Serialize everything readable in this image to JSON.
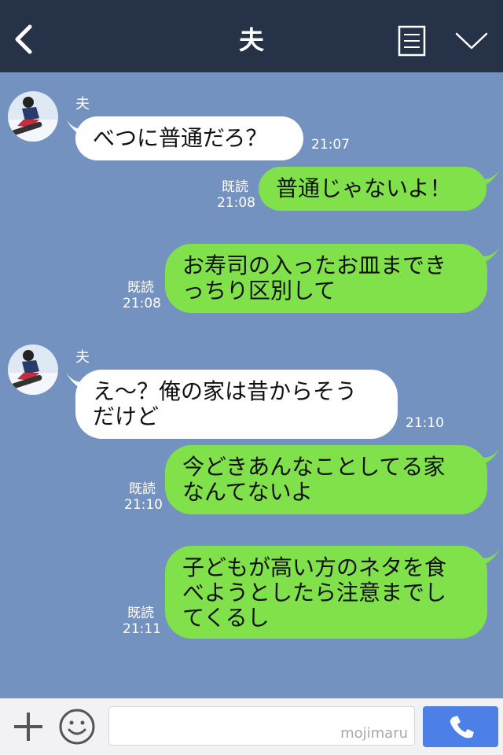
{
  "header": {
    "title": "夫",
    "back_icon": "chevron-left-icon",
    "note_icon": "note-list-icon",
    "menu_icon": "chevron-down-icon"
  },
  "messages": [
    {
      "from": "in",
      "sender": "夫",
      "text": "べつに普通だろ？",
      "time": "21:07"
    },
    {
      "from": "out",
      "read": "既読",
      "text": "普通じゃないよ！",
      "time": "21:08"
    },
    {
      "from": "out",
      "read": "既読",
      "text": "お寿司の入ったお皿までき\nっちり区別して",
      "time": "21:08"
    },
    {
      "from": "in",
      "sender": "夫",
      "text": "え〜？俺の家は昔からそう\nだけど",
      "time": "21:10"
    },
    {
      "from": "out",
      "read": "既読",
      "text": "今どきあんなことしてる家\nなんてないよ",
      "time": "21:10"
    },
    {
      "from": "out",
      "read": "既読",
      "text": "子どもが高い方のネタを食\nべようとしたら注意までし\nてくるし",
      "time": "21:11"
    }
  ],
  "footer": {
    "watermark": "mojimaru",
    "plus_icon": "plus-icon",
    "emoji_icon": "smiley-icon",
    "call_icon": "phone-icon"
  },
  "colors": {
    "header_bg": "#263248",
    "chat_bg": "#7392bf",
    "out_bubble": "#80e14b",
    "in_bubble": "#ffffff",
    "call_button": "#4c80e6"
  }
}
